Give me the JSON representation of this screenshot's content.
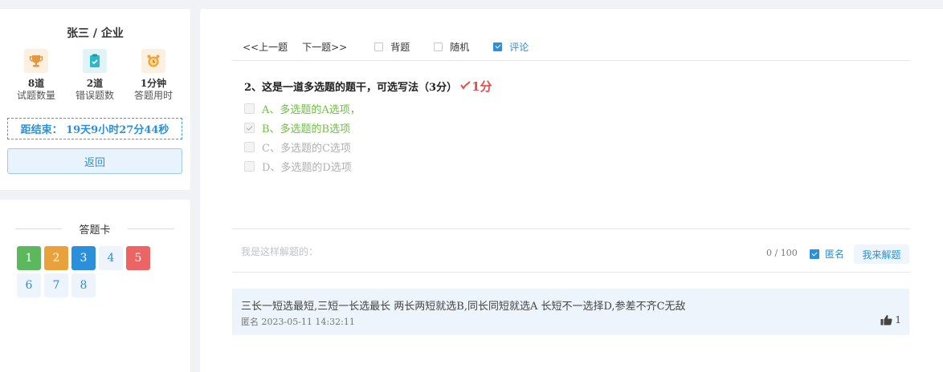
{
  "user": {
    "name": "张三 / 企业"
  },
  "stats": [
    {
      "icon": "trophy-icon",
      "value": "8道",
      "label": "试题数量",
      "bg": "#fdf0e1"
    },
    {
      "icon": "clipboard-icon",
      "value": "2道",
      "label": "错误题数",
      "bg": "#e0f4f7"
    },
    {
      "icon": "alarm-clock-icon",
      "value": "1分钟",
      "label": "答题用时",
      "bg": "#fdf0e1"
    }
  ],
  "countdown": "距结束： 19天9小时27分44秒",
  "back_label": "返回",
  "answer_card": {
    "title": "答题卡",
    "items": [
      {
        "num": "1",
        "status": "correct",
        "bg": "#5cb85c",
        "fg": "#ffffff"
      },
      {
        "num": "2",
        "status": "partial",
        "bg": "#e9a23b",
        "fg": "#ffffff"
      },
      {
        "num": "3",
        "status": "current",
        "bg": "#2b8fdc",
        "fg": "#ffffff"
      },
      {
        "num": "4",
        "status": "unanswered",
        "bg": "#edf4fc",
        "fg": "#2b8fdc"
      },
      {
        "num": "5",
        "status": "wrong",
        "bg": "#ec6464",
        "fg": "#ffffff"
      },
      {
        "num": "6",
        "status": "unanswered",
        "bg": "#edf4fc",
        "fg": "#2b8fdc"
      },
      {
        "num": "7",
        "status": "unanswered",
        "bg": "#edf4fc",
        "fg": "#2b8fdc"
      },
      {
        "num": "8",
        "status": "unanswered",
        "bg": "#edf4fc",
        "fg": "#2b8fdc"
      }
    ]
  },
  "nav": {
    "prev": "<<上一题",
    "next": "下一题>>",
    "options": [
      {
        "label": "背题",
        "checked": false
      },
      {
        "label": "随机",
        "checked": false
      },
      {
        "label": "评论",
        "checked": true
      }
    ]
  },
  "question": {
    "title": "2、这是一道多选题的题干，可选写法（3分）",
    "mark": "1分",
    "options": [
      {
        "text": "A、多选题的A选项，",
        "selected": false,
        "style": "green"
      },
      {
        "text": "B、多选题的B选项",
        "selected": true,
        "style": "green"
      },
      {
        "text": "C、多选题的C选项",
        "selected": false,
        "style": "gray"
      },
      {
        "text": "D、多选题的D选项",
        "selected": false,
        "style": "gray"
      }
    ]
  },
  "comment_input": {
    "placeholder": "我是这样解题的：",
    "counter": "0 / 100",
    "anonymous_label": "匿名",
    "anonymous_checked": true,
    "submit_label": "我来解题"
  },
  "comments": [
    {
      "text": "三长一短选最短,三短一长选最长 两长两短就选B,同长同短就选A 长短不一选择D,参差不齐C无敌",
      "author": "匿名",
      "time": "2023-05-11 14:32:11",
      "likes": "1"
    }
  ]
}
